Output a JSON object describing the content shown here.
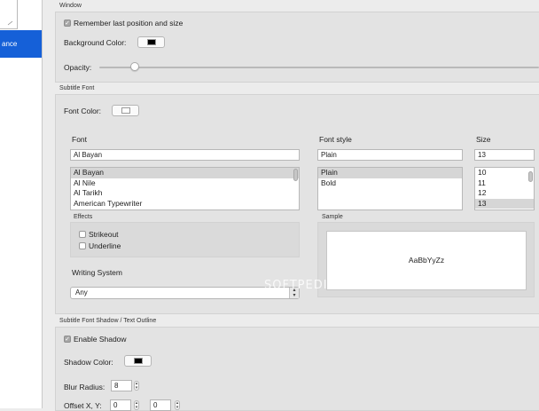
{
  "sidebar": {
    "selected_label": "ance"
  },
  "window_section": {
    "title": "Window",
    "remember_label": "Remember last position and size",
    "bg_color_label": "Background Color:",
    "bg_color": "#000000",
    "opacity_label": "Opacity:",
    "opacity_value": 0.08
  },
  "subtitle_font": {
    "title": "Subtitle Font",
    "font_color_label": "Font Color:",
    "font_color": "#ffffff",
    "font_header": "Font",
    "font_value": "Al Bayan",
    "fonts": [
      "Al Bayan",
      "Al Nile",
      "Al Tarikh",
      "American Typewriter"
    ],
    "style_header": "Font style",
    "style_value": "Plain",
    "styles": [
      "Plain",
      "Bold"
    ],
    "size_header": "Size",
    "size_value": "13",
    "sizes": [
      "10",
      "11",
      "12",
      "13"
    ],
    "effects_title": "Effects",
    "strikeout_label": "Strikeout",
    "underline_label": "Underline",
    "sample_title": "Sample",
    "sample_text": "AaBbYyZz",
    "writing_system_label": "Writing System",
    "writing_system_value": "Any"
  },
  "shadow_section": {
    "title": "Subtitle Font Shadow / Text Outline",
    "enable_label": "Enable Shadow",
    "shadow_color_label": "Shadow Color:",
    "shadow_color": "#000000",
    "blur_label": "Blur Radius:",
    "blur_value": "8",
    "offset_label": "Offset X, Y:",
    "offset_x": "0",
    "offset_y": "0"
  },
  "watermark": "SOFTPEDIA"
}
